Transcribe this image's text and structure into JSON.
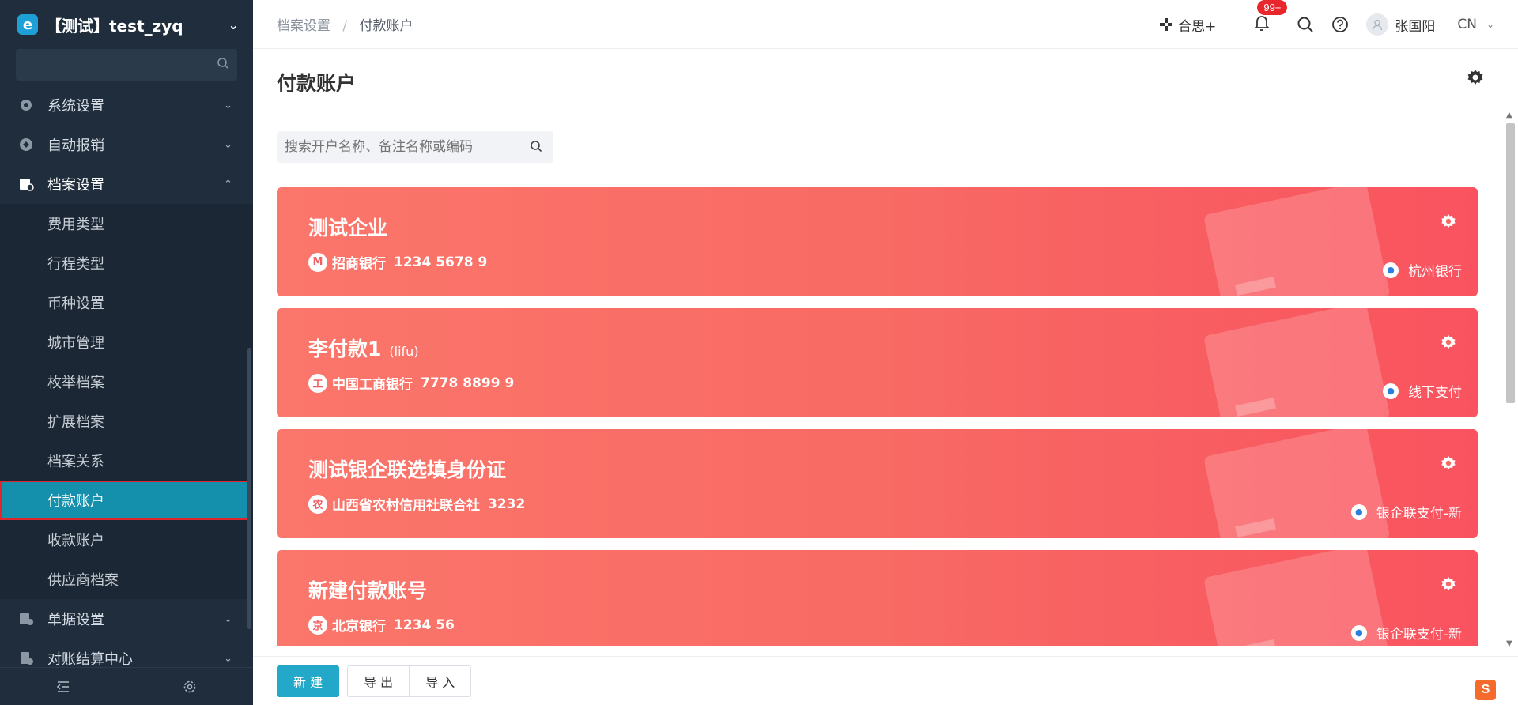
{
  "sidebar": {
    "title": "【测试】test_zyq",
    "search_placeholder": "",
    "items": [
      {
        "label": "系统设置",
        "icon": "gear-icon",
        "expanded": false
      },
      {
        "label": "自动报销",
        "icon": "automation-icon",
        "expanded": false
      },
      {
        "label": "档案设置",
        "icon": "archive-settings-icon",
        "expanded": true
      }
    ],
    "subitems": [
      {
        "label": "费用类型"
      },
      {
        "label": "行程类型"
      },
      {
        "label": "币种设置"
      },
      {
        "label": "城市管理"
      },
      {
        "label": "枚举档案"
      },
      {
        "label": "扩展档案"
      },
      {
        "label": "档案关系"
      },
      {
        "label": "付款账户",
        "active": true
      },
      {
        "label": "收款账户"
      },
      {
        "label": "供应商档案"
      }
    ],
    "items_after": [
      {
        "label": "单据设置",
        "icon": "document-settings-icon"
      },
      {
        "label": "对账结算中心",
        "icon": "settlement-icon"
      }
    ]
  },
  "breadcrumb": {
    "parent": "档案设置",
    "separator": "/",
    "current": "付款账户"
  },
  "topbar": {
    "hesi_label": "合思+",
    "notification_badge": "99+",
    "user_name": "张国阳",
    "language": "CN"
  },
  "main": {
    "title": "付款账户",
    "search_placeholder": "搜索开户名称、备注名称或编码"
  },
  "accounts": [
    {
      "name": "测试企业",
      "code": "",
      "bank": "招商银行",
      "bank_icon": "M",
      "number": "1234 5678 9",
      "payment": "杭州银行"
    },
    {
      "name": "李付款1",
      "code": "(lifu)",
      "bank": "中国工商银行",
      "bank_icon": "工",
      "number": "7778 8899 9",
      "payment": "线下支付"
    },
    {
      "name": "测试银企联选填身份证",
      "code": "",
      "bank": "山西省农村信用社联合社",
      "bank_icon": "农",
      "number": "3232",
      "payment": "银企联支付-新"
    },
    {
      "name": "新建付款账号",
      "code": "",
      "bank": "北京银行",
      "bank_icon": "京",
      "number": "1234 56",
      "payment": "银企联支付-新"
    }
  ],
  "footer": {
    "new_label": "新 建",
    "export_label": "导 出",
    "import_label": "导 入"
  },
  "colors": {
    "sidebar_bg": "#1f2d3d",
    "active_item": "#1490ad",
    "card_gradient_start": "#fb766b",
    "card_gradient_end": "#f9535f",
    "primary_button": "#23a8c9",
    "badge": "#e8262c"
  }
}
